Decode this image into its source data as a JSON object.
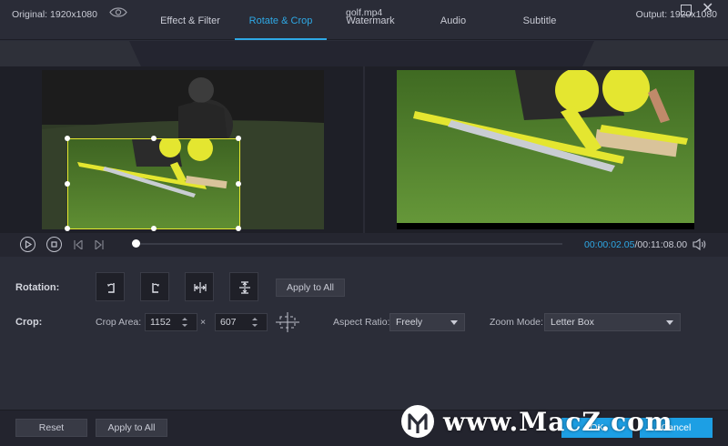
{
  "tabs": [
    {
      "label": "Effect & Filter",
      "active": false
    },
    {
      "label": "Rotate & Crop",
      "active": true
    },
    {
      "label": "Watermark",
      "active": false
    },
    {
      "label": "Audio",
      "active": false
    },
    {
      "label": "Subtitle",
      "active": false
    }
  ],
  "window": {
    "maximize_icon": "maximize-icon",
    "close_icon": "close-icon",
    "close_glyph": "✕"
  },
  "preview": {
    "original_label": "Original: 1920x1080",
    "output_label": "Output: 1920x1080",
    "filename": "golf.mp4"
  },
  "playback": {
    "current_time": "00:00:02.05",
    "separator": "/",
    "total_time": "00:11:08.00",
    "progress": 0.003
  },
  "rotation": {
    "label": "Rotation:",
    "buttons": [
      "rotate-left-icon",
      "rotate-right-icon",
      "flip-horizontal-icon",
      "flip-vertical-icon"
    ],
    "apply_all": "Apply to All"
  },
  "crop": {
    "label": "Crop:",
    "area_label": "Crop Area:",
    "width": "1152",
    "times": "×",
    "height": "607",
    "aspect_label": "Aspect Ratio:",
    "aspect_value": "Freely",
    "zoom_label": "Zoom Mode:",
    "zoom_value": "Letter Box"
  },
  "footer": {
    "reset": "Reset",
    "apply_all": "Apply to All",
    "ok": "OK",
    "cancel": "Cancel"
  },
  "watermark_text": "www.MacZ.com",
  "colors": {
    "accent": "#2ea8e5",
    "crop_border": "#e6e830",
    "primary_button": "#1d9fe4"
  }
}
